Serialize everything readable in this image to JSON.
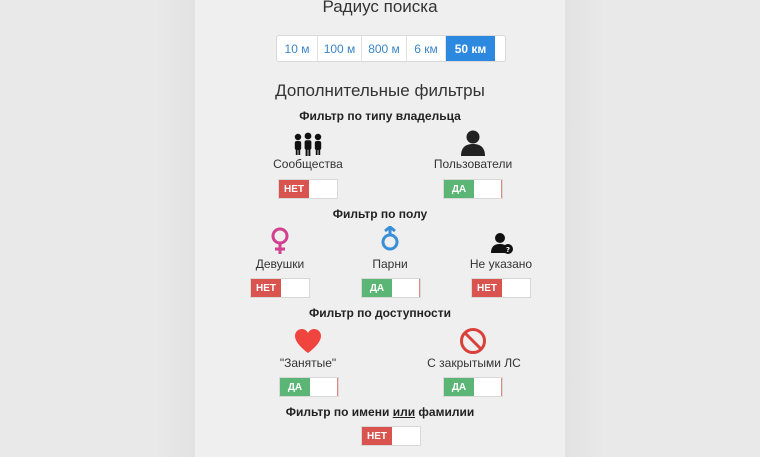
{
  "header": {
    "title": "Радиус поиска"
  },
  "radius": {
    "options": [
      "10 м",
      "100 м",
      "800 м",
      "6 км",
      "50 км"
    ],
    "active_index": 4
  },
  "filters": {
    "title": "Дополнительные фильтры",
    "owner_type": {
      "title": "Фильтр по типу владельца",
      "items": [
        {
          "label": "Сообщества",
          "icon": "group-icon",
          "toggle": "НЕТ",
          "state": false
        },
        {
          "label": "Пользователи",
          "icon": "user-icon",
          "toggle": "ДА",
          "state": true
        }
      ]
    },
    "gender": {
      "title": "Фильтр по полу",
      "items": [
        {
          "label": "Девушки",
          "icon": "female-icon",
          "toggle": "НЕТ",
          "state": false
        },
        {
          "label": "Парни",
          "icon": "male-icon",
          "toggle": "ДА",
          "state": true
        },
        {
          "label": "Не указано",
          "icon": "unknown-user-icon",
          "toggle": "НЕТ",
          "state": false
        }
      ]
    },
    "availability": {
      "title": "Фильтр по доступности",
      "items": [
        {
          "label": "\"Занятые\"",
          "icon": "heart-icon",
          "toggle": "ДА",
          "state": true
        },
        {
          "label": "С закрытыми ЛС",
          "icon": "no-entry-icon",
          "toggle": "ДА",
          "state": true
        }
      ]
    },
    "name": {
      "title_part1": "Фильтр по имени ",
      "title_underlined": "или",
      "title_part2": " фамилии",
      "toggle": "НЕТ",
      "state": false
    }
  },
  "colors": {
    "accent": "#2d89e0",
    "yes": "#5bb575",
    "no": "#d9534f",
    "female": "#d2418f",
    "male": "#3a8fd8",
    "heart": "#f0443f",
    "no_entry": "#d9403a"
  }
}
